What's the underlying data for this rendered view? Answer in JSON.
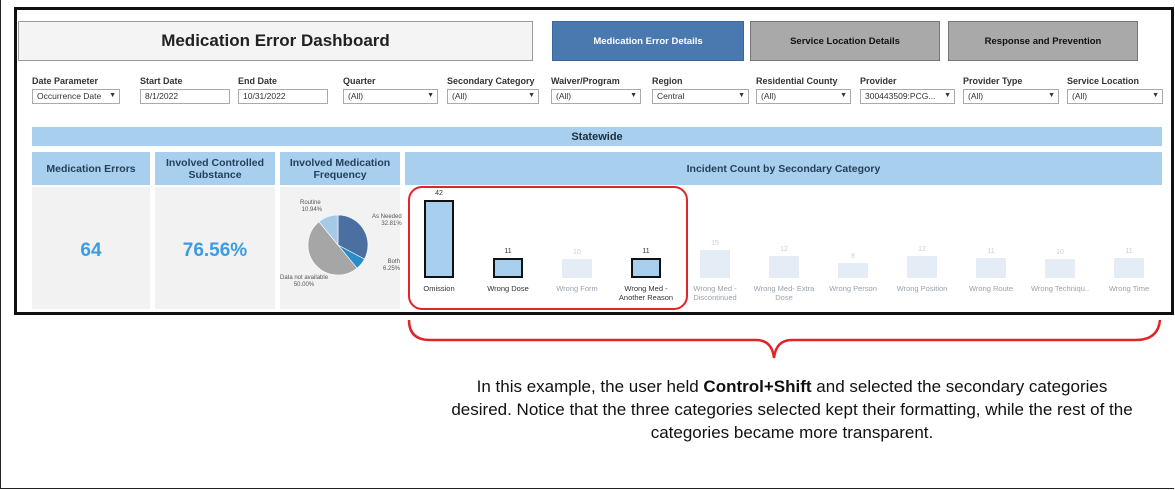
{
  "header": {
    "title": "Medication Error Dashboard",
    "tabs": [
      {
        "label": "Medication Error Details",
        "active": true
      },
      {
        "label": "Service Location Details",
        "active": false
      },
      {
        "label": "Response and Prevention",
        "active": false
      }
    ]
  },
  "filters": [
    {
      "label": "Date Parameter",
      "value": "Occurrence Date",
      "dropdown": true
    },
    {
      "label": "Start Date",
      "value": "8/1/2022",
      "dropdown": false
    },
    {
      "label": "End Date",
      "value": "10/31/2022",
      "dropdown": false
    },
    {
      "label": "Quarter",
      "value": "(All)",
      "dropdown": true
    },
    {
      "label": "Secondary Category",
      "value": "(All)",
      "dropdown": true
    },
    {
      "label": "Waiver/Program",
      "value": "(All)",
      "dropdown": true
    },
    {
      "label": "Region",
      "value": "Central",
      "dropdown": true
    },
    {
      "label": "Residential County",
      "value": "(All)",
      "dropdown": true
    },
    {
      "label": "Provider",
      "value": "300443509:PCG...",
      "dropdown": true
    },
    {
      "label": "Provider Type",
      "value": "(All)",
      "dropdown": true
    },
    {
      "label": "Service Location",
      "value": "(All)",
      "dropdown": true
    }
  ],
  "statewide": "Statewide",
  "kpis": [
    {
      "title": "Medication Errors",
      "value": "64"
    },
    {
      "title": "Involved Controlled Substance",
      "value": "76.56%"
    },
    {
      "title": "Involved Medication Frequency",
      "value": ""
    }
  ],
  "pie": {
    "colors": {
      "routine": "#a6c9e6",
      "as_needed": "#4b6fa0",
      "both": "#2a8bc9",
      "not_available": "#a6a6a6"
    },
    "labels": [
      {
        "name": "Routine",
        "pct": "10.94%"
      },
      {
        "name": "As Needed",
        "pct": "32.81%"
      },
      {
        "name": "Both",
        "pct": "6.25%"
      },
      {
        "name": "Data not available",
        "pct": "50.00%"
      }
    ]
  },
  "chart_data": {
    "type": "bar",
    "title": "Incident Count by Secondary Category",
    "categories": [
      "Omission",
      "Wrong Dose",
      "Wrong Form",
      "Wrong Med - Another Reason",
      "Wrong Med - Discontinued",
      "Wrong Med- Extra Dose",
      "Wrong Person",
      "Wrong Position",
      "Wrong Route",
      "Wrong Techniqu..",
      "Wrong Time"
    ],
    "values": [
      42,
      11,
      10,
      11,
      15,
      12,
      8,
      12,
      11,
      10,
      11
    ],
    "selected": [
      true,
      true,
      false,
      true,
      false,
      false,
      false,
      false,
      false,
      false,
      false
    ]
  },
  "caption": {
    "part1": "In this example, the user held ",
    "bold": "Control+Shift",
    "part2": " and selected the secondary categories desired.  Notice that the three categories selected kept their formatting, while the rest of the categories became more transparent."
  },
  "colors": {
    "accent": "#4a79b0",
    "header_band": "#a8d0ee",
    "kpi_value": "#3b9be3",
    "annotation": "#e0242a"
  }
}
